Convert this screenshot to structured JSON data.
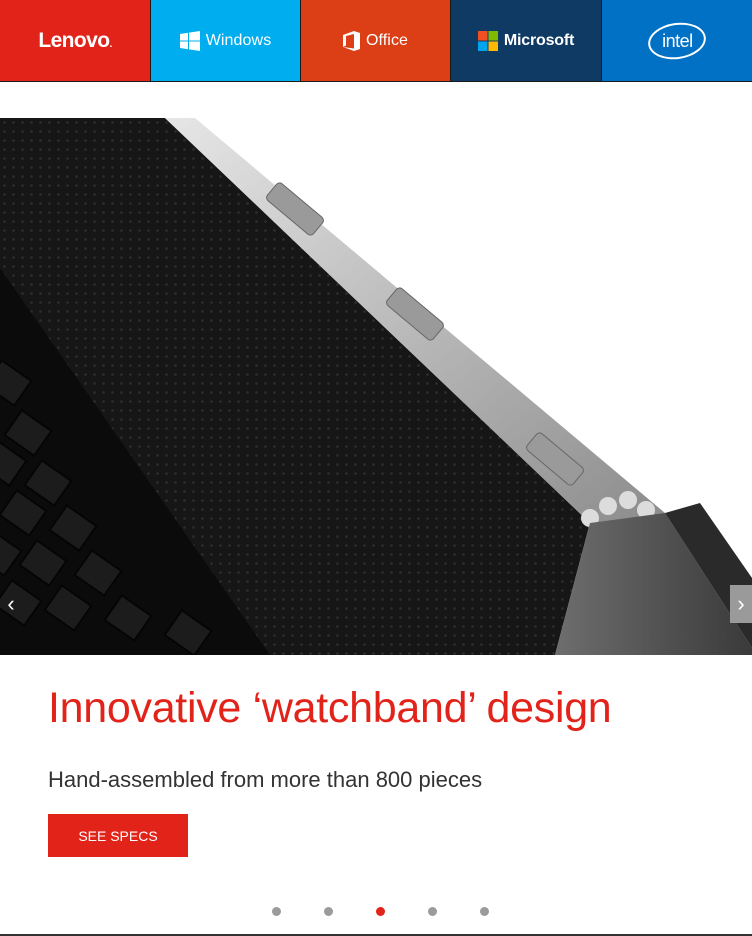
{
  "brands": [
    {
      "name": "Lenovo",
      "color": "#e2231a",
      "icon": "lenovo-logo"
    },
    {
      "name": "Windows",
      "color": "#00adef",
      "icon": "windows-logo-icon"
    },
    {
      "name": "Office",
      "color": "#dc3e15",
      "icon": "office-logo-icon"
    },
    {
      "name": "Microsoft",
      "color": "#0f3a63",
      "icon": "microsoft-logo-icon"
    },
    {
      "name": "intel",
      "color": "#0071c5",
      "icon": "intel-logo"
    }
  ],
  "hero": {
    "image": "laptop-watchband-hinge",
    "prev_icon": "chevron-left-icon",
    "next_icon": "chevron-right-icon",
    "prev_glyph": "‹",
    "next_glyph": "›"
  },
  "slide": {
    "headline": "Innovative ‘watchband’ design",
    "subhead": "Hand-assembled from more than 800 pieces",
    "cta": "SEE SPECS"
  },
  "carousel": {
    "count": 5,
    "active_index": 2,
    "accent": "#e2231a"
  }
}
